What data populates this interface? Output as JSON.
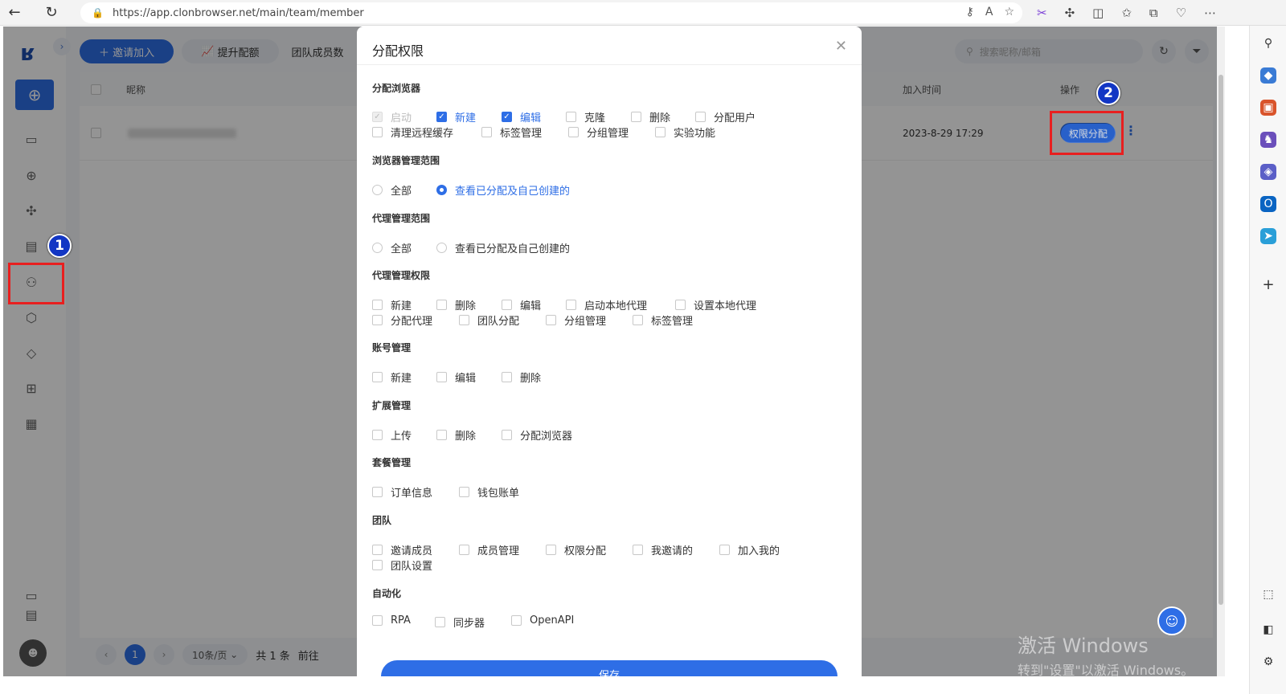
{
  "browser": {
    "url": "https://app.clonbrowser.net/main/team/member"
  },
  "toolbar": {
    "invite_label": "邀请加入",
    "upgrade_label": "提升配额",
    "team_count_label": "团队成员数",
    "search_placeholder": "搜索昵称/邮箱"
  },
  "table": {
    "columns": {
      "nickname": "昵称",
      "join_time": "加入时间",
      "action": "操作"
    },
    "rows": [
      {
        "join_time": "2023-8-29 17:29",
        "action_button": "权限分配"
      }
    ]
  },
  "pager": {
    "current": "1",
    "page_size": "10条/页",
    "total": "共 1 条",
    "goto": "前往"
  },
  "modal": {
    "title": "分配权限",
    "save_label": "保存",
    "sections": {
      "browser": {
        "title": "分配浏览器",
        "options": [
          "启动",
          "新建",
          "编辑",
          "克隆",
          "删除",
          "分配用户",
          "清理远程缓存",
          "标签管理",
          "分组管理",
          "实验功能"
        ]
      },
      "browser_scope": {
        "title": "浏览器管理范围",
        "options": [
          "全部",
          "查看已分配及自己创建的"
        ]
      },
      "proxy_scope": {
        "title": "代理管理范围",
        "options": [
          "全部",
          "查看已分配及自己创建的"
        ]
      },
      "proxy_perm": {
        "title": "代理管理权限",
        "options": [
          "新建",
          "删除",
          "编辑",
          "启动本地代理",
          "设置本地代理",
          "分配代理",
          "团队分配",
          "分组管理",
          "标签管理"
        ]
      },
      "account": {
        "title": "账号管理",
        "options": [
          "新建",
          "编辑",
          "删除"
        ]
      },
      "extension": {
        "title": "扩展管理",
        "options": [
          "上传",
          "删除",
          "分配浏览器"
        ]
      },
      "plan": {
        "title": "套餐管理",
        "options": [
          "订单信息",
          "钱包账单"
        ]
      },
      "team": {
        "title": "团队",
        "options": [
          "邀请成员",
          "成员管理",
          "权限分配",
          "我邀请的",
          "加入我的",
          "团队设置"
        ]
      },
      "automation": {
        "title": "自动化",
        "options": [
          "RPA",
          "同步器",
          "OpenAPI"
        ]
      }
    }
  },
  "annotations": {
    "badge1": "1",
    "badge2": "2"
  },
  "watermark": {
    "line1": "激活 Windows",
    "line2": "转到\"设置\"以激活 Windows。"
  },
  "colors": {
    "accent": "#2e6ee6",
    "highlight": "#e81f1f",
    "badge": "#1236c4"
  }
}
